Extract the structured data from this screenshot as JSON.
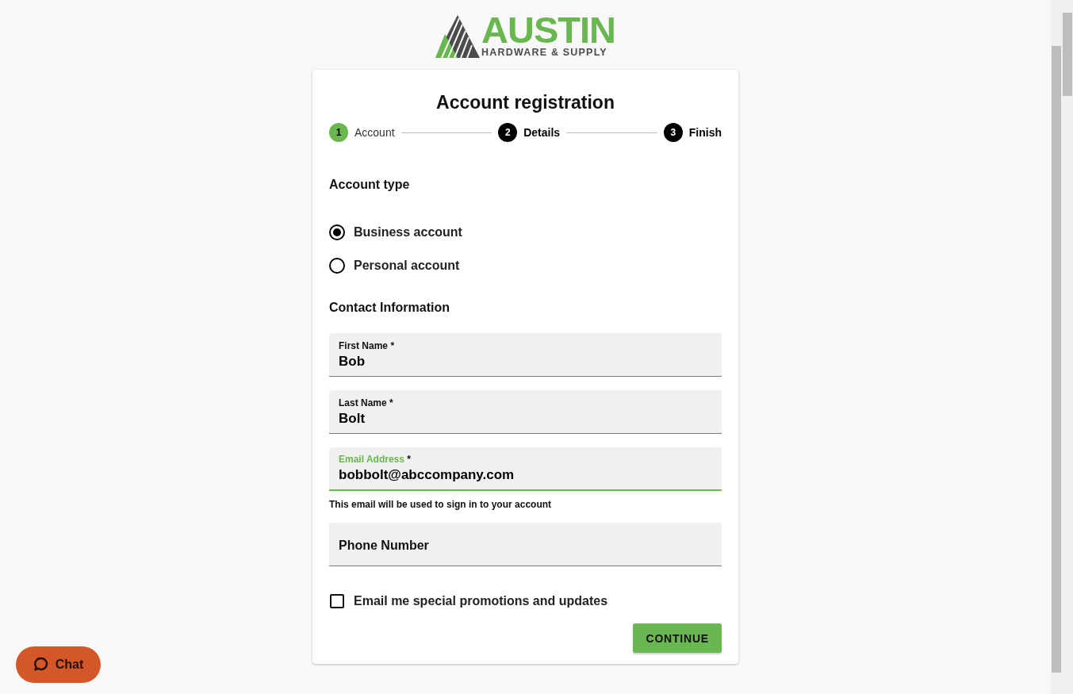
{
  "logo": {
    "name": "AUSTIN",
    "tagline": "HARDWARE & SUPPLY"
  },
  "title": "Account registration",
  "steps": [
    {
      "number": "1",
      "label": "Account",
      "completed": true
    },
    {
      "number": "2",
      "label": "Details",
      "completed": false
    },
    {
      "number": "3",
      "label": "Finish",
      "completed": false
    }
  ],
  "account_type": {
    "heading": "Account type",
    "options": [
      {
        "label": "Business account",
        "selected": true
      },
      {
        "label": "Personal account",
        "selected": false
      }
    ]
  },
  "contact": {
    "heading": "Contact Information",
    "fields": [
      {
        "label": "First Name",
        "required": "*",
        "value": "Bob",
        "focused": false
      },
      {
        "label": "Last Name",
        "required": "*",
        "value": "Bolt",
        "focused": false
      },
      {
        "label": "Email Address",
        "required": "*",
        "value": "bobbolt@abccompany.com",
        "focused": true,
        "helper": "This email will be used to sign in to your account"
      },
      {
        "placeholder": "Phone Number",
        "focused": false
      }
    ]
  },
  "promotions": {
    "label": "Email me special promotions and updates",
    "checked": false
  },
  "continue_button": "CONTINUE",
  "chat_button": "Chat"
}
